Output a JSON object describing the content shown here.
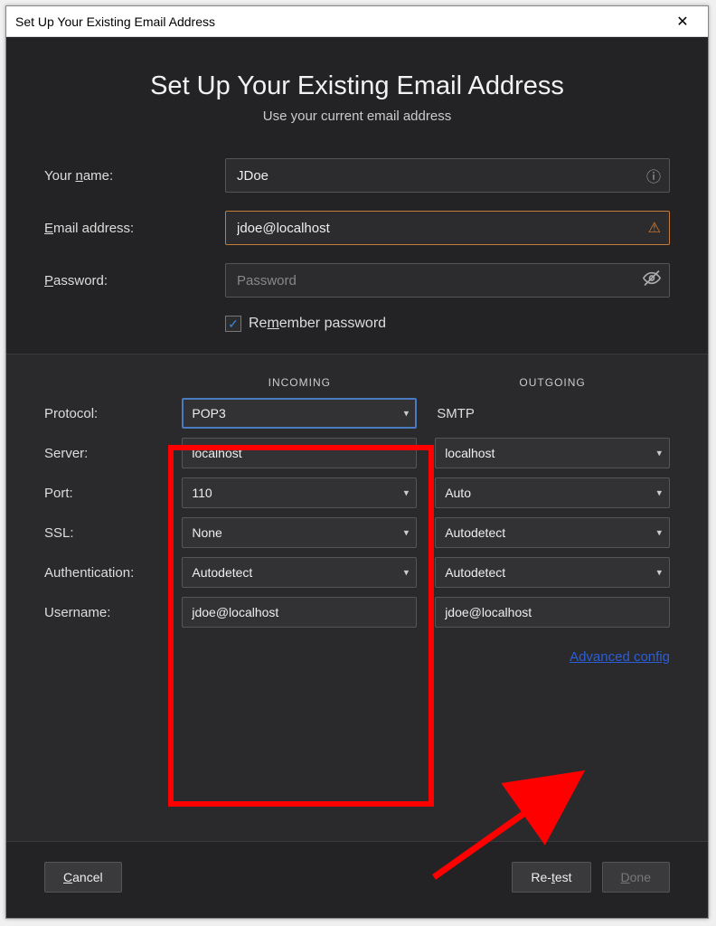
{
  "window_title": "Set Up Your Existing Email Address",
  "header": {
    "title": "Set Up Your Existing Email Address",
    "subtitle": "Use your current email address"
  },
  "form": {
    "name_label_pre": "Your ",
    "name_label_ul": "n",
    "name_label_post": "ame:",
    "name_value": "JDoe",
    "email_label_ul": "E",
    "email_label_post": "mail address:",
    "email_value": "jdoe@localhost",
    "password_label_ul": "P",
    "password_label_post": "assword:",
    "password_placeholder": "Password",
    "remember_label_pre": "Re",
    "remember_label_ul": "m",
    "remember_label_post": "ember password",
    "remember_checked": true
  },
  "server": {
    "incoming_label": "INCOMING",
    "outgoing_label": "OUTGOING",
    "rows": {
      "protocol": {
        "label": "Protocol:",
        "in": "POP3",
        "out": "SMTP"
      },
      "server": {
        "label": "Server:",
        "in": "localhost",
        "out": "localhost"
      },
      "port": {
        "label": "Port:",
        "in": "110",
        "out": "Auto"
      },
      "ssl": {
        "label": "SSL:",
        "in": "None",
        "out": "Autodetect"
      },
      "auth": {
        "label": "Authentication:",
        "in": "Autodetect",
        "out": "Autodetect"
      },
      "user": {
        "label": "Username:",
        "in": "jdoe@localhost",
        "out": "jdoe@localhost"
      }
    },
    "advanced_link": "Advanced config"
  },
  "footer": {
    "cancel_ul": "C",
    "cancel_post": "ancel",
    "retest_pre": "Re-",
    "retest_ul": "t",
    "retest_post": "est",
    "done_ul": "D",
    "done_post": "one"
  }
}
